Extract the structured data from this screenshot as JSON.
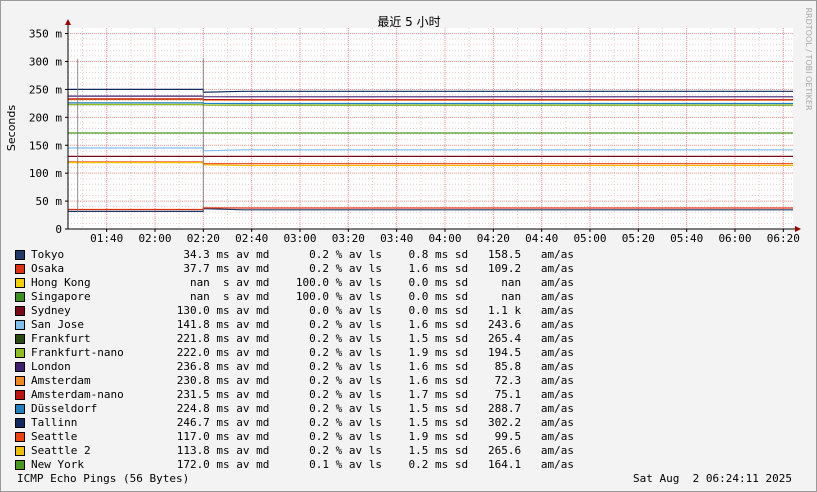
{
  "chart_data": {
    "type": "line",
    "title": "最近 5 小时",
    "ylabel": "Seconds",
    "watermark": "RRDTOOL / TOBI OETIKER",
    "ylim": [
      0,
      0.36
    ],
    "y_ticks": [
      {
        "value": 0,
        "label": "0"
      },
      {
        "value": 0.05,
        "label": "50 m"
      },
      {
        "value": 0.1,
        "label": "100 m"
      },
      {
        "value": 0.15,
        "label": "150 m"
      },
      {
        "value": 0.2,
        "label": "200 m"
      },
      {
        "value": 0.25,
        "label": "250 m"
      },
      {
        "value": 0.3,
        "label": "300 m"
      },
      {
        "value": 0.35,
        "label": "350 m"
      }
    ],
    "x_range": [
      "01:24",
      "06:24"
    ],
    "x_ticks": [
      "01:40",
      "02:00",
      "02:20",
      "02:40",
      "03:00",
      "03:20",
      "03:40",
      "04:00",
      "04:20",
      "04:40",
      "05:00",
      "05:20",
      "05:40",
      "06:00",
      "06:20"
    ],
    "grid": true,
    "series": [
      {
        "name": "Tokyo",
        "color": "#1f3a6b",
        "values": [
          0.0315,
          0.0365,
          0.0343
        ],
        "avg": "34.3 ms",
        "loss": "0.2 %",
        "sd": "0.8 ms",
        "am": "158.5"
      },
      {
        "name": "Osaka",
        "color": "#e03010",
        "values": [
          0.035,
          0.038,
          0.0377
        ],
        "avg": "37.7 ms",
        "loss": "0.2 %",
        "sd": "1.6 ms",
        "am": "109.2"
      },
      {
        "name": "Hong Kong",
        "color": "#f5d000",
        "values": null,
        "avg": "nan  s",
        "loss": "100.0 %",
        "sd": "0.0 ms",
        "am": "nan"
      },
      {
        "name": "Singapore",
        "color": "#3f8f20",
        "values": null,
        "avg": "nan  s",
        "loss": "100.0 %",
        "sd": "0.0 ms",
        "am": "nan"
      },
      {
        "name": "Sydney",
        "color": "#7a0a1a",
        "values": [
          0.13,
          0.13,
          0.13
        ],
        "avg": "130.0 ms",
        "loss": "0.0 %",
        "sd": "0.0 ms",
        "am": "1.1 k"
      },
      {
        "name": "San Jose",
        "color": "#80c0f0",
        "values": [
          0.145,
          0.14,
          0.1418
        ],
        "avg": "141.8 ms",
        "loss": "0.2 %",
        "sd": "1.6 ms",
        "am": "243.6"
      },
      {
        "name": "Frankfurt",
        "color": "#2a4a10",
        "values": [
          0.223,
          0.222,
          0.2218
        ],
        "avg": "221.8 ms",
        "loss": "0.2 %",
        "sd": "1.5 ms",
        "am": "265.4"
      },
      {
        "name": "Frankfurt-nano",
        "color": "#90c020",
        "values": [
          0.223,
          0.222,
          0.222
        ],
        "avg": "222.0 ms",
        "loss": "0.2 %",
        "sd": "1.9 ms",
        "am": "194.5"
      },
      {
        "name": "London",
        "color": "#402070",
        "values": [
          0.238,
          0.237,
          0.2368
        ],
        "avg": "236.8 ms",
        "loss": "0.2 %",
        "sd": "1.6 ms",
        "am": "85.8"
      },
      {
        "name": "Amsterdam",
        "color": "#f08a20",
        "values": [
          0.232,
          0.231,
          0.2308
        ],
        "avg": "230.8 ms",
        "loss": "0.2 %",
        "sd": "1.6 ms",
        "am": "72.3"
      },
      {
        "name": "Amsterdam-nano",
        "color": "#c01010",
        "values": [
          0.233,
          0.232,
          0.2315
        ],
        "avg": "231.5 ms",
        "loss": "0.2 %",
        "sd": "1.7 ms",
        "am": "75.1"
      },
      {
        "name": "Düsseldorf",
        "color": "#2080c0",
        "values": [
          0.226,
          0.225,
          0.2248
        ],
        "avg": "224.8 ms",
        "loss": "0.2 %",
        "sd": "1.5 ms",
        "am": "288.7"
      },
      {
        "name": "Tallinn",
        "color": "#102a60",
        "values": [
          0.25,
          0.245,
          0.2467
        ],
        "avg": "246.7 ms",
        "loss": "0.2 %",
        "sd": "1.5 ms",
        "am": "302.2"
      },
      {
        "name": "Seattle",
        "color": "#f04010",
        "values": [
          0.12,
          0.117,
          0.117
        ],
        "avg": "117.0 ms",
        "loss": "0.2 %",
        "sd": "1.9 ms",
        "am": "99.5"
      },
      {
        "name": "Seattle 2",
        "color": "#f0c000",
        "values": [
          0.119,
          0.115,
          0.1138
        ],
        "avg": "113.8 ms",
        "loss": "0.2 %",
        "sd": "1.5 ms",
        "am": "265.6"
      },
      {
        "name": "New York",
        "color": "#4a9a20",
        "values": [
          0.172,
          0.172,
          0.172
        ],
        "avg": "172.0 ms",
        "loss": "0.1 %",
        "sd": "0.2 ms",
        "am": "164.1"
      }
    ]
  },
  "footer": {
    "left": "ICMP Echo Pings (56 Bytes)",
    "right": "Sat Aug  2 06:24:11 2025"
  },
  "legend_suffix": {
    "avg": "av md",
    "loss": "av ls",
    "sd": "sd",
    "am": "am/as"
  }
}
